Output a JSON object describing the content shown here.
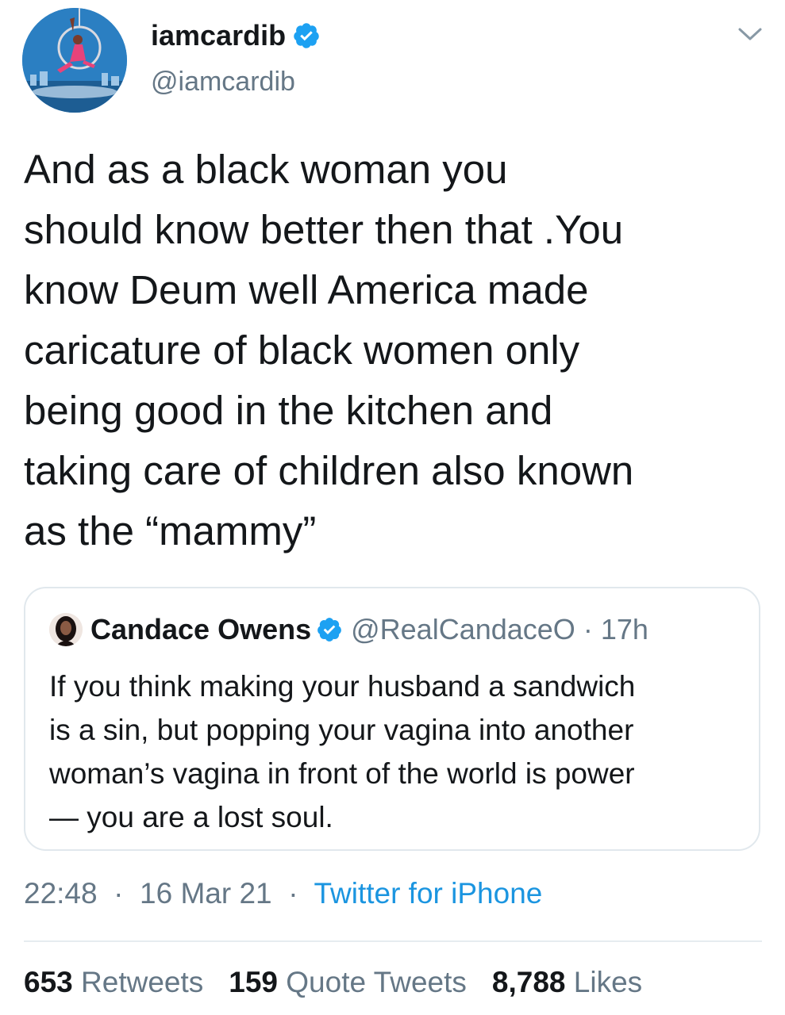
{
  "tweet": {
    "author": {
      "display_name": "iamcardib",
      "handle": "@iamcardib",
      "verified": true,
      "avatar_icon": "profile-photo"
    },
    "menu_icon": "chevron-down-icon",
    "text": "And as a black woman you\nshould know better then that .You\nknow Deum well America made\ncaricature of black women only\nbeing good in the kitchen and\ntaking care of children also known\nas the “mammy”",
    "quoted": {
      "display_name": "Candace Owens",
      "handle": "@RealCandaceO",
      "separator": "·",
      "time": "17h",
      "verified": true,
      "text": "If you think making your husband a sandwich\nis a sin, but popping your vagina into another\nwoman’s vagina in front of the world is power\n— you are a lost soul."
    },
    "timestamp": {
      "time": "22:48",
      "separator": "·",
      "date": "16 Mar 21",
      "source": "Twitter for iPhone"
    },
    "stats": [
      {
        "count": "653",
        "label": "Retweets"
      },
      {
        "count": "159",
        "label": "Quote Tweets"
      },
      {
        "count": "8,788",
        "label": "Likes"
      }
    ]
  },
  "colors": {
    "text_primary": "#14171a",
    "text_secondary": "#657786",
    "link_blue": "#1b95e0",
    "verified_blue": "#1da1f2",
    "border": "#e1e8ed"
  }
}
